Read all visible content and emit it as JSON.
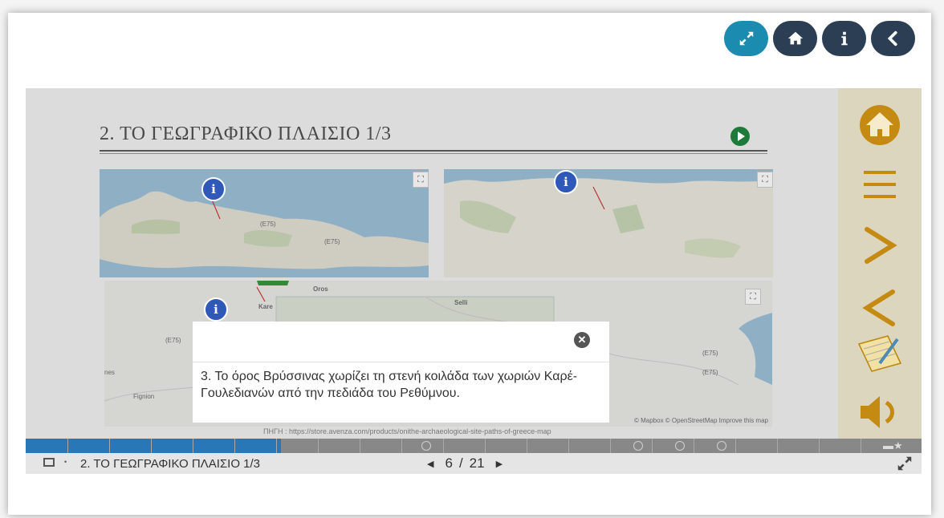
{
  "toolbar": {
    "buttons": [
      {
        "name": "fullscreen",
        "icon": "expand-icon"
      },
      {
        "name": "home",
        "icon": "home-icon"
      },
      {
        "name": "info",
        "icon": "info-icon"
      },
      {
        "name": "back",
        "icon": "chevron-left-icon"
      }
    ],
    "accent_color": "#1b8bb0",
    "dark_color": "#2c3e54"
  },
  "slide": {
    "title": "2. ΤΟ ΓΕΩΓΡΑΦΙΚΟ ΠΛΑΙΣΙΟ 1/3",
    "maps": [
      {
        "name": "crete-overview-map",
        "labels": [
          "(E75)",
          "(E75)"
        ]
      },
      {
        "name": "region-map",
        "labels": []
      },
      {
        "name": "valley-detail-map",
        "labels": [
          "Oros",
          "Selli",
          "Kare",
          "(E75)",
          "(E75)",
          "(E75)",
          "Fignion",
          "nes"
        ]
      }
    ],
    "source_prefix": "ΠΗΓΗ",
    "source_url": "https://store.avenza.com/products/onithe-archaeological-site-paths-of-greece-map",
    "attribution": "© Mapbox © OpenStreetMap Improve this map"
  },
  "popup": {
    "close_icon": "close-icon",
    "text": "3. Το όρος Βρύσσινας χωρίζει τη στενή κοιλάδα των χωριών Καρέ-Γουλεδιανών από την πεδιάδα του Ρεθύμνου."
  },
  "sidebar": {
    "items": [
      "home-icon",
      "menu-icon",
      "next-icon",
      "previous-icon",
      "notebook-icon",
      "speaker-icon"
    ]
  },
  "footer": {
    "breadcrumb": "2. ΤΟ ΓΕΩΓΡΑΦΙΚΟ ΠΛΑΙΣΙΟ 1/3",
    "current_page": "6",
    "separator": "/",
    "total_pages": "21",
    "progress": 0.285
  }
}
